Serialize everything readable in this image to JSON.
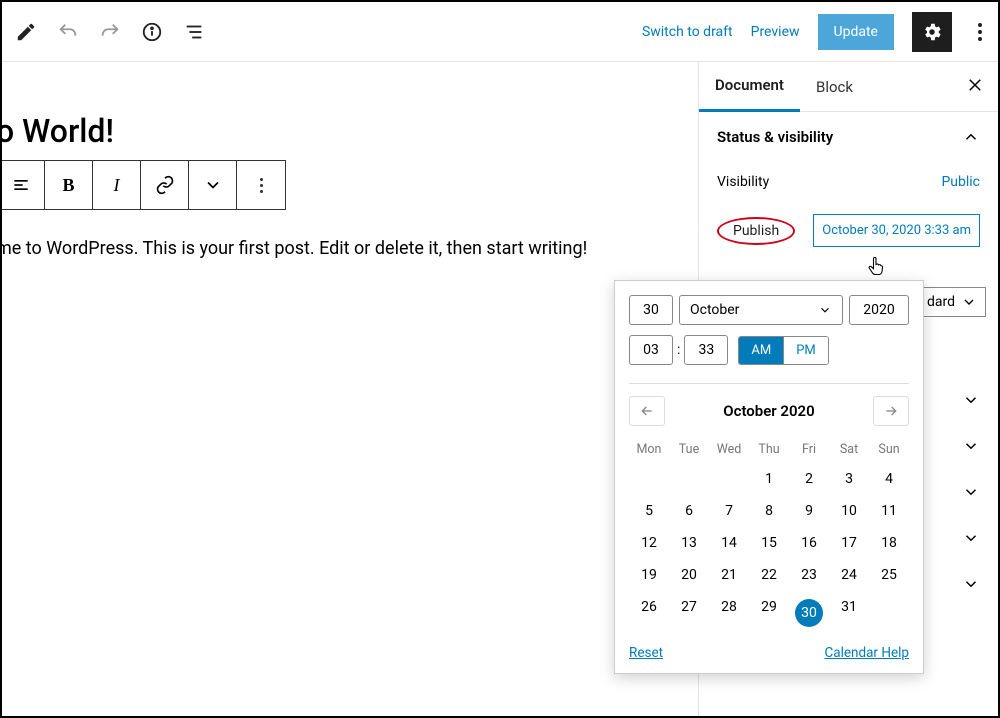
{
  "topbar": {
    "switch_to_draft": "Switch to draft",
    "preview": "Preview",
    "update": "Update"
  },
  "post": {
    "title": "o World!",
    "paragraph": "me to WordPress. This is your first post. Edit or delete it, then start writing!"
  },
  "toolbar": {
    "bold": "B",
    "italic": "I"
  },
  "sidebar": {
    "tabs": {
      "document": "Document",
      "block": "Block"
    },
    "panel_title": "Status & visibility",
    "visibility_label": "Visibility",
    "visibility_value": "Public",
    "publish_label": "Publish",
    "publish_date": "October 30, 2020 3:33 am",
    "format_value": "dard"
  },
  "datepicker": {
    "day": "30",
    "month": "October",
    "year": "2020",
    "hour": "03",
    "minute": "33",
    "am": "AM",
    "pm": "PM",
    "header": "October 2020",
    "weekdays": [
      "Mon",
      "Tue",
      "Wed",
      "Thu",
      "Fri",
      "Sat",
      "Sun"
    ],
    "weeks": [
      [
        "",
        "",
        "",
        "1",
        "2",
        "3",
        "4"
      ],
      [
        "5",
        "6",
        "7",
        "8",
        "9",
        "10",
        "11"
      ],
      [
        "12",
        "13",
        "14",
        "15",
        "16",
        "17",
        "18"
      ],
      [
        "19",
        "20",
        "21",
        "22",
        "23",
        "24",
        "25"
      ],
      [
        "26",
        "27",
        "28",
        "29",
        "30",
        "31",
        ""
      ]
    ],
    "selected": "30",
    "reset": "Reset",
    "help": "Calendar Help"
  }
}
